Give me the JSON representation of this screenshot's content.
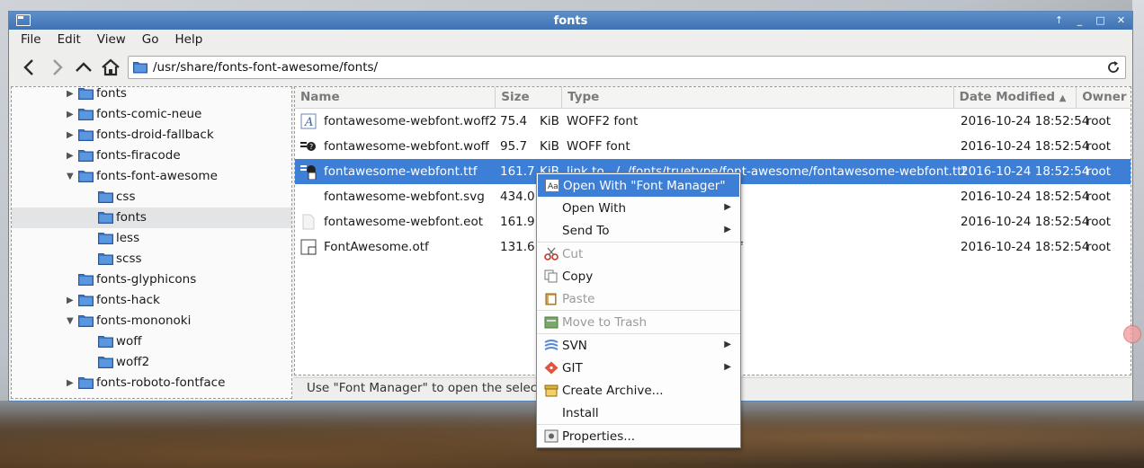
{
  "window": {
    "title": "fonts",
    "controls": [
      "↑",
      "_",
      "□",
      "✕"
    ]
  },
  "menubar": [
    "File",
    "Edit",
    "View",
    "Go",
    "Help"
  ],
  "toolbar": {
    "path": "/usr/share/fonts-font-awesome/fonts/",
    "icons": [
      "back-arrow-icon",
      "forward-arrow-icon",
      "up-arrow-icon",
      "home-icon",
      "reload-icon"
    ]
  },
  "sidebar": {
    "items": [
      {
        "label": "fonts",
        "expander": "collapsed",
        "depth": 0
      },
      {
        "label": "fonts-comic-neue",
        "expander": "collapsed",
        "depth": 0
      },
      {
        "label": "fonts-droid-fallback",
        "expander": "collapsed",
        "depth": 0
      },
      {
        "label": "fonts-firacode",
        "expander": "collapsed",
        "depth": 0
      },
      {
        "label": "fonts-font-awesome",
        "expander": "expanded",
        "depth": 0
      },
      {
        "label": "css",
        "expander": "none",
        "depth": 1
      },
      {
        "label": "fonts",
        "expander": "none",
        "depth": 1,
        "selected": true
      },
      {
        "label": "less",
        "expander": "none",
        "depth": 1
      },
      {
        "label": "scss",
        "expander": "none",
        "depth": 1
      },
      {
        "label": "fonts-glyphicons",
        "expander": "none",
        "depth": 0
      },
      {
        "label": "fonts-hack",
        "expander": "collapsed",
        "depth": 0
      },
      {
        "label": "fonts-mononoki",
        "expander": "expanded",
        "depth": 0
      },
      {
        "label": "woff",
        "expander": "none",
        "depth": 1
      },
      {
        "label": "woff2",
        "expander": "none",
        "depth": 1
      },
      {
        "label": "fonts-roboto-fontface",
        "expander": "collapsed",
        "depth": 0
      }
    ]
  },
  "filelist": {
    "columns": [
      "Name",
      "Size",
      "Type",
      "Date Modified",
      "Owner"
    ],
    "sort_indicator": "▲",
    "rows": [
      {
        "name": "fontawesome-webfont.woff2",
        "size": "75.4",
        "unit": "KiB",
        "type": "WOFF2 font",
        "modified": "2016-10-24 18:52:54",
        "owner": "root"
      },
      {
        "name": "fontawesome-webfont.woff",
        "size": "95.7",
        "unit": "KiB",
        "type": "WOFF font",
        "modified": "2016-10-24 18:52:54",
        "owner": "root"
      },
      {
        "name": "fontawesome-webfont.ttf",
        "size": "161.7",
        "unit": "KiB",
        "type": "link to ../../fonts/truetype/font-awesome/fontawesome-webfont.ttf",
        "modified": "2016-10-24 18:52:54",
        "owner": "root",
        "selected": true
      },
      {
        "name": "fontawesome-webfont.svg",
        "size": "434.0",
        "unit": "",
        "type": "",
        "modified": "2016-10-24 18:52:54",
        "owner": "root"
      },
      {
        "name": "fontawesome-webfont.eot",
        "size": "161.9",
        "unit": "",
        "type": "",
        "modified": "2016-10-24 18:52:54",
        "owner": "root"
      },
      {
        "name": "FontAwesome.otf",
        "size": "131.6",
        "unit": "",
        "type": "t-awesome/FontAwesome.otf",
        "modified": "2016-10-24 18:52:54",
        "owner": "root"
      }
    ]
  },
  "statusbar": {
    "text": "Use \"Font Manager\" to open the selecte"
  },
  "context_menu": {
    "items": [
      {
        "label": "Open With \"Font Manager\"",
        "icon": "font-manager-icon",
        "highlight": true
      },
      {
        "label": "Open With",
        "submenu": true
      },
      {
        "label": "Send To",
        "submenu": true
      },
      {
        "separator": true
      },
      {
        "label": "Cut",
        "icon": "scissors-icon",
        "disabled": true
      },
      {
        "label": "Copy",
        "icon": "copy-icon"
      },
      {
        "label": "Paste",
        "icon": "paste-icon",
        "disabled": true
      },
      {
        "separator": true
      },
      {
        "label": "Move to Trash",
        "icon": "trash-icon",
        "disabled": true
      },
      {
        "separator": true
      },
      {
        "label": "SVN",
        "icon": "svn-icon",
        "submenu": true
      },
      {
        "label": "GIT",
        "icon": "git-icon",
        "submenu": true
      },
      {
        "label": "Create Archive...",
        "icon": "archive-icon"
      },
      {
        "label": "Install"
      },
      {
        "separator": true
      },
      {
        "label": "Properties...",
        "icon": "properties-icon"
      }
    ]
  },
  "colors": {
    "titlebar": "#4a7dbf",
    "selection": "#3d7fd6"
  }
}
